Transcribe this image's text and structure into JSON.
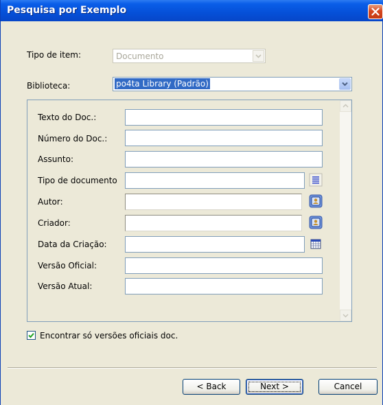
{
  "window": {
    "title": "Pesquisa por Exemplo"
  },
  "tipo_item": {
    "label": "Tipo de item:",
    "value": "Documento"
  },
  "biblioteca": {
    "label": "Biblioteca:",
    "value": "po4ta Library  (Padrão)"
  },
  "fields": {
    "texto_doc": "Texto do Doc.:",
    "numero_doc": "Número do Doc.:",
    "assunto": "Assunto:",
    "tipo_documento": "Tipo de documento",
    "autor": "Autor:",
    "criador": "Criador:",
    "data_criacao": "Data da Criação:",
    "versao_oficial": "Versão Oficial:",
    "versao_atual": "Versão Atual:"
  },
  "checkbox": {
    "label": "Encontrar só versões oficiais doc.",
    "checked": true
  },
  "buttons": {
    "back": "< Back",
    "next": "Next >",
    "cancel": "Cancel"
  },
  "colors": {
    "titlebar": "#0550d8",
    "dialog_bg": "#ece9d8",
    "selection": "#316ac5",
    "close": "#d6461f"
  }
}
